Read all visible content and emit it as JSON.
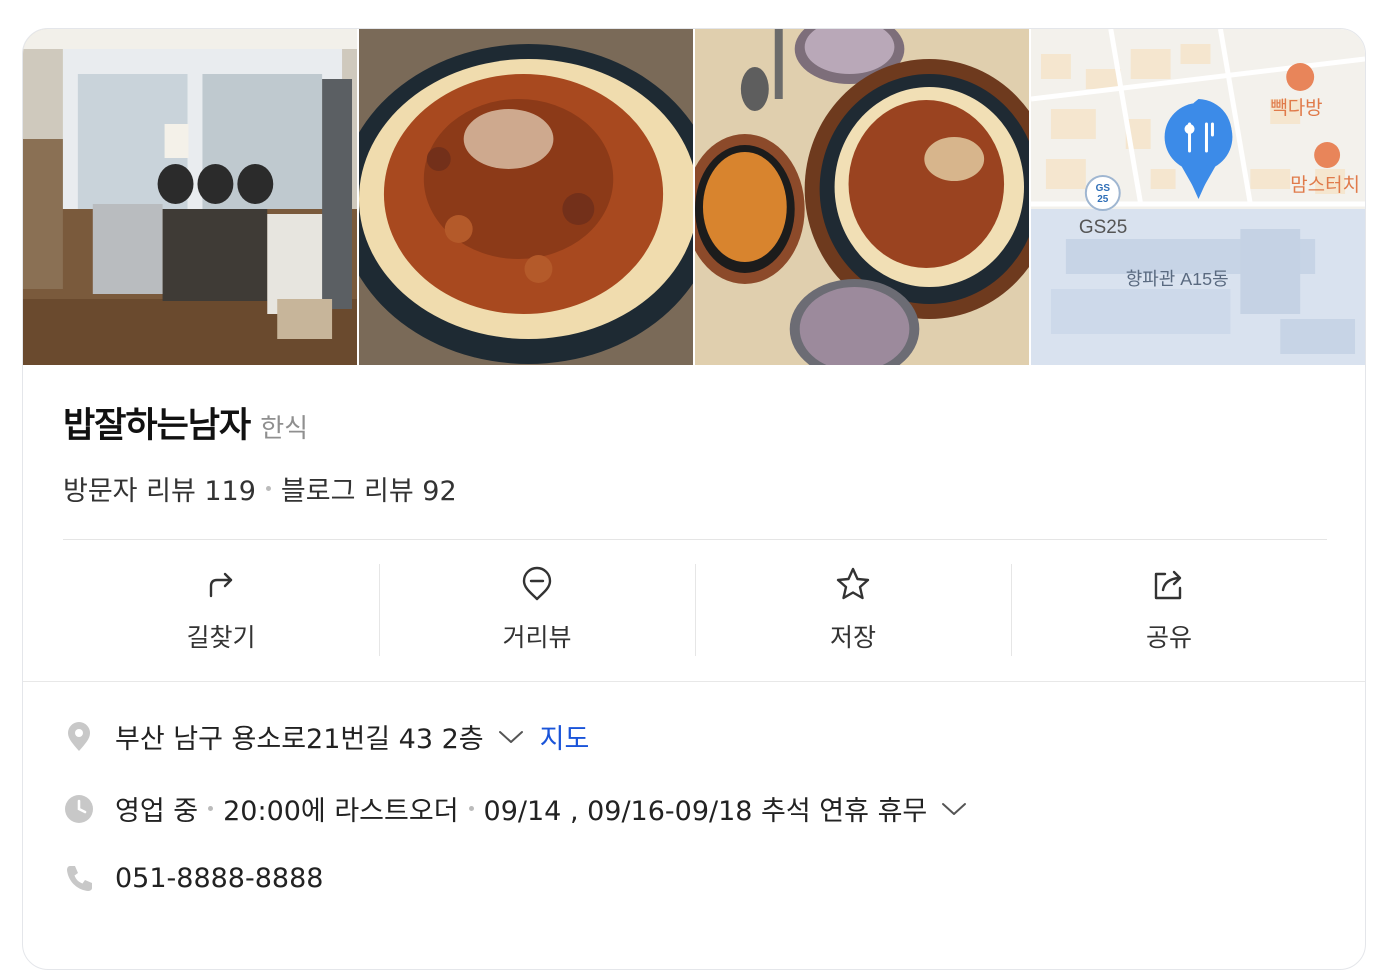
{
  "place": {
    "name": "밥잘하는남자",
    "category": "한식",
    "visitor_reviews": "방문자 리뷰 119",
    "blog_reviews": "블로그 리뷰 92"
  },
  "photos": [
    {
      "name": "restaurant-interior-photo"
    },
    {
      "name": "food-photo-1"
    },
    {
      "name": "food-photo-2"
    },
    {
      "name": "map-thumbnail"
    }
  ],
  "map_thumb": {
    "labels": [
      "빽다방",
      "맘스터치",
      "GS25",
      "향파관 A15동"
    ],
    "gs_badge": "GS 25"
  },
  "actions": [
    {
      "label": "길찾기",
      "icon": "directions-icon"
    },
    {
      "label": "거리뷰",
      "icon": "street-view-icon"
    },
    {
      "label": "저장",
      "icon": "star-icon"
    },
    {
      "label": "공유",
      "icon": "share-icon"
    }
  ],
  "info": {
    "address": "부산 남구 용소로21번길 43 2층",
    "map_link": "지도",
    "status": "영업 중",
    "last_order": "20:00에 라스트오더",
    "holiday": "09/14 , 09/16-09/18 추석 연휴 휴무",
    "phone": "051-8888-8888"
  },
  "colors": {
    "link": "#1a54d9",
    "pin": "#3c8be8",
    "map_poi": "#e8855a"
  }
}
